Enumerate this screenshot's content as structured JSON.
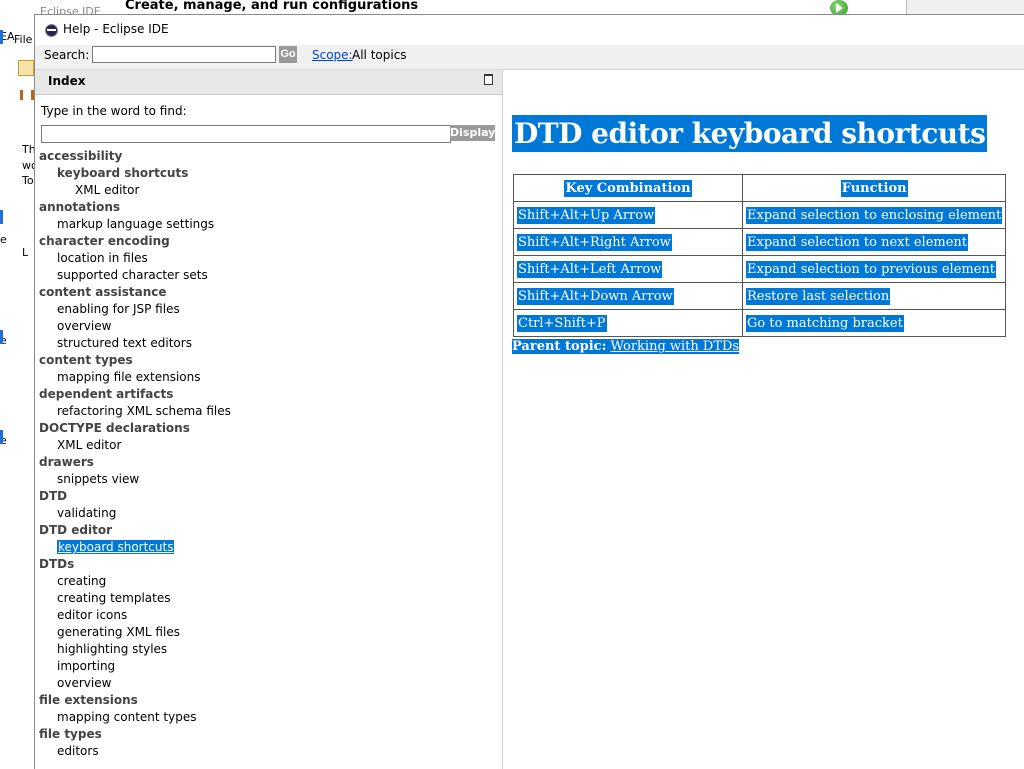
{
  "background": {
    "app_tab": "Eclipse IDE",
    "heading": "Create, manage, and run configurations",
    "fragments": [
      "EA",
      "File",
      "Th",
      "wo",
      "To",
      "e",
      "L",
      "e",
      "e"
    ]
  },
  "help_window": {
    "title": "Help - Eclipse IDE",
    "search": {
      "label": "Search:",
      "value": "",
      "go_label": "Go",
      "scope_label": "Scope:",
      "scope_value": "All topics"
    }
  },
  "index": {
    "title": "Index",
    "find_label": "Type in the word to find:",
    "find_value": "",
    "display_label": "Display",
    "entries": [
      {
        "text": "accessibility",
        "level": 0
      },
      {
        "text": "keyboard shortcuts",
        "level": "1b"
      },
      {
        "text": "XML editor",
        "level": 2
      },
      {
        "text": "annotations",
        "level": 0
      },
      {
        "text": "markup language settings",
        "level": 1
      },
      {
        "text": "character encoding",
        "level": 0
      },
      {
        "text": "location in files",
        "level": 1
      },
      {
        "text": "supported character sets",
        "level": 1
      },
      {
        "text": "content assistance",
        "level": 0
      },
      {
        "text": "enabling for JSP files",
        "level": 1
      },
      {
        "text": "overview",
        "level": 1
      },
      {
        "text": "structured text editors",
        "level": 1
      },
      {
        "text": "content types",
        "level": 0
      },
      {
        "text": "mapping file extensions",
        "level": 1
      },
      {
        "text": "dependent artifacts",
        "level": 0
      },
      {
        "text": "refactoring XML schema files",
        "level": 1
      },
      {
        "text": "DOCTYPE declarations",
        "level": 0
      },
      {
        "text": "XML editor",
        "level": 1
      },
      {
        "text": "drawers",
        "level": 0
      },
      {
        "text": "snippets view",
        "level": 1
      },
      {
        "text": "DTD",
        "level": 0
      },
      {
        "text": "validating",
        "level": 1
      },
      {
        "text": "DTD editor",
        "level": 0
      },
      {
        "text": "keyboard shortcuts",
        "level": 1,
        "selected": true
      },
      {
        "text": "DTDs",
        "level": 0
      },
      {
        "text": "creating",
        "level": 1
      },
      {
        "text": "creating templates",
        "level": 1
      },
      {
        "text": "editor icons",
        "level": 1
      },
      {
        "text": "generating XML files",
        "level": 1
      },
      {
        "text": "highlighting styles",
        "level": 1
      },
      {
        "text": "importing",
        "level": 1
      },
      {
        "text": "overview",
        "level": 1
      },
      {
        "text": "file extensions",
        "level": 0
      },
      {
        "text": "mapping content types",
        "level": 1
      },
      {
        "text": "file types",
        "level": 0
      },
      {
        "text": "editors",
        "level": 1
      }
    ]
  },
  "content": {
    "title": "DTD editor keyboard shortcuts",
    "table": {
      "headers": [
        "Key Combination",
        "Function"
      ],
      "rows": [
        [
          "Shift+Alt+Up Arrow",
          "Expand selection to enclosing element"
        ],
        [
          "Shift+Alt+Right Arrow",
          "Expand selection to next element"
        ],
        [
          "Shift+Alt+Left Arrow",
          "Expand selection to previous element"
        ],
        [
          "Shift+Alt+Down Arrow",
          "Restore last selection"
        ],
        [
          "Ctrl+Shift+P",
          "Go to matching bracket"
        ]
      ]
    },
    "parent_topic_label": "Parent topic:",
    "parent_topic_link": "Working with DTDs"
  },
  "colors": {
    "highlight": "#0078d7",
    "link": "#0044cc",
    "button_gray": "#9a9a9a"
  }
}
